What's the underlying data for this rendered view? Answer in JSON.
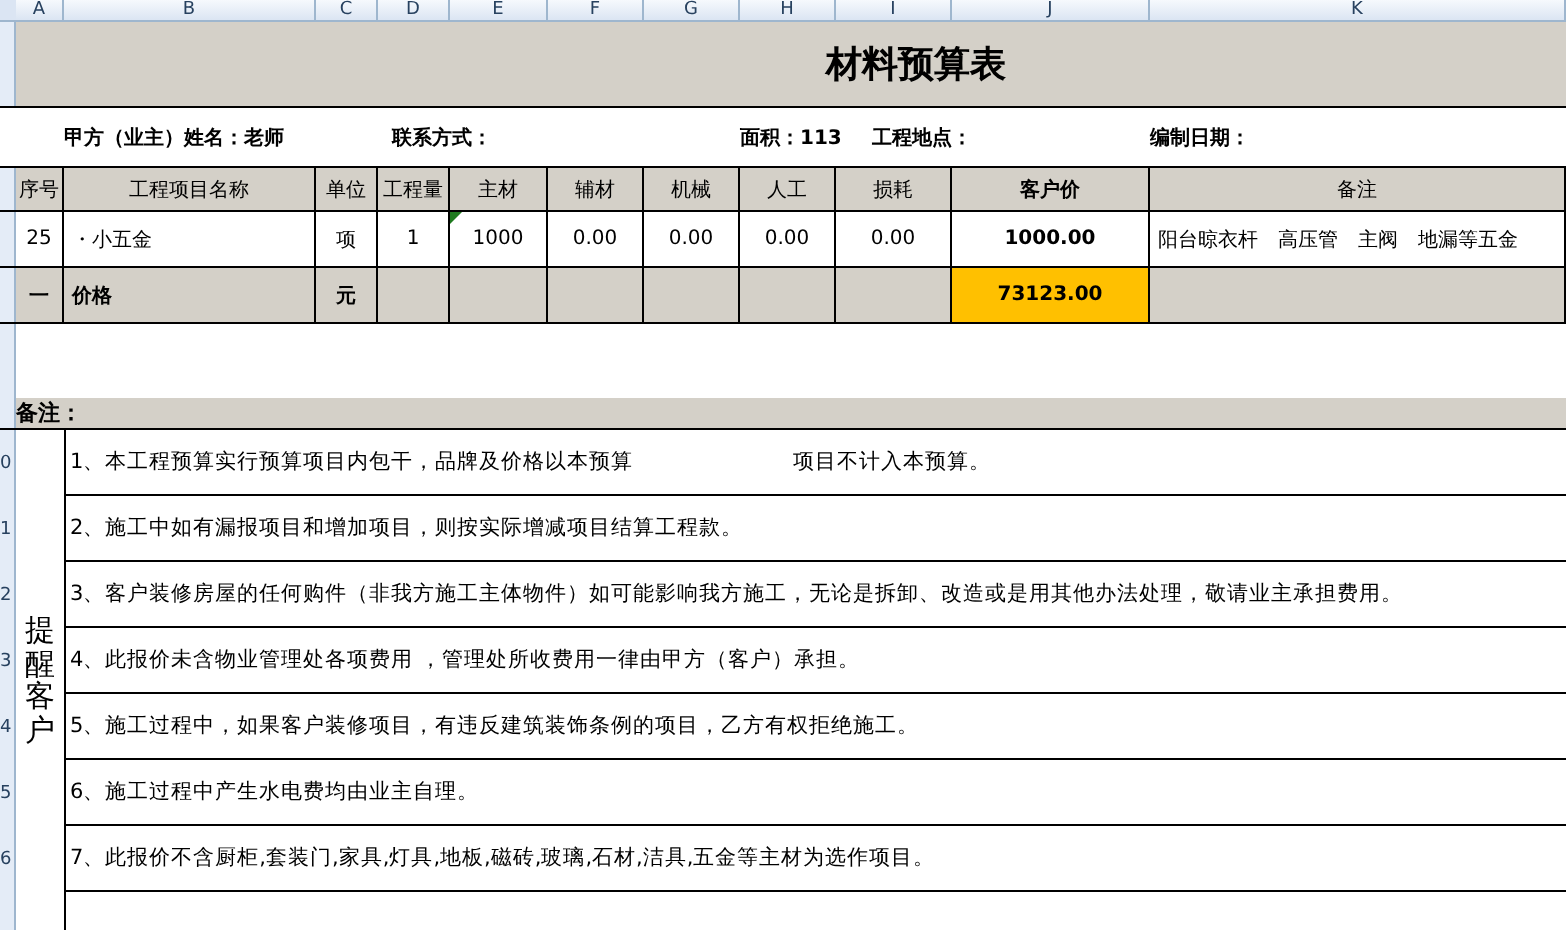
{
  "columns": [
    "A",
    "B",
    "C",
    "D",
    "E",
    "F",
    "G",
    "H",
    "I",
    "J",
    "K"
  ],
  "title": "材料预算表",
  "info": [
    "甲方（业主）姓名：老师",
    "联系方式：",
    "面积：113",
    "工程地点：",
    "编制日期："
  ],
  "header": [
    "序号",
    "工程项目名称",
    "单位",
    "工程量",
    "主材",
    "辅材",
    "机械",
    "人工",
    "损耗",
    "客户价",
    "备注"
  ],
  "row": [
    "25",
    "・小五金",
    "项",
    "1",
    "1000",
    "0.00",
    "0.00",
    "0.00",
    "0.00",
    "1000.00",
    "阳台晾衣杆　高压管　主阀　地漏等五金"
  ],
  "total": {
    "index": "一",
    "label": "价格",
    "unit": "元",
    "value": "73123.00"
  },
  "notes_label": "备注：",
  "side_label": "提醒客户",
  "row_headers": [
    "0",
    "1",
    "2",
    "3",
    "4",
    "5",
    "6"
  ],
  "notes": [
    [
      "1、本工程预算实行预算项目内包干，品牌及价格以本预算",
      "项目不计入本预算。"
    ],
    [
      "2、施工中如有漏报项目和增加项目，则按实际增减项目结算工程款。"
    ],
    [
      "3、客户装修房屋的任何购件（非我方施工主体物件）如可能影响我方施工，无论是拆卸、改造或是用其他办法处理，敬请业主承担费用。"
    ],
    [
      "4、此报价未含物业管理处各项费用 ，管理处所收费用一律由甲方（客户）承担。"
    ],
    [
      "5、施工过程中，如果客户装修项目，有违反建筑装饰条例的项目，乙方有权拒绝施工。"
    ],
    [
      "6、施工过程中产生水电费均由业主自理。"
    ],
    [
      "7、此报价不含厨柜,套装门,家具,灯具,地板,磁砖,玻璃,石材,洁具,五金等主材为选作项目。"
    ]
  ]
}
